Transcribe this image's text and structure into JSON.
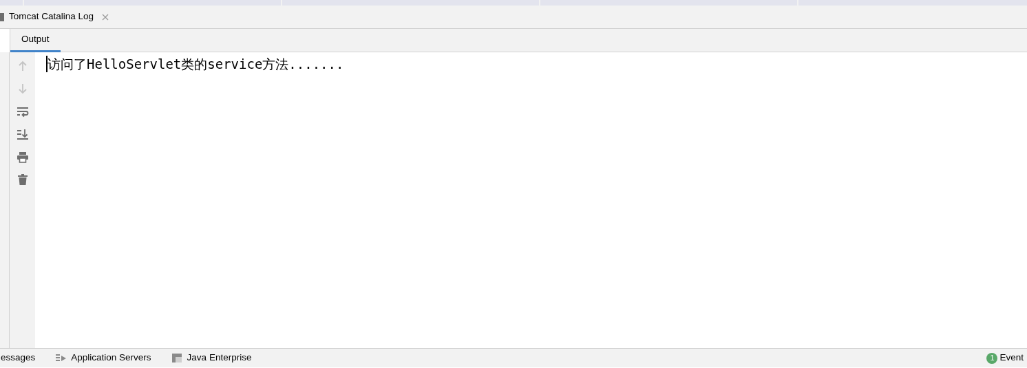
{
  "tool_window": {
    "title": "Tomcat Catalina Log"
  },
  "tabs": [
    {
      "label": "Output",
      "selected": true
    }
  ],
  "toolbar": [
    {
      "kind": "up",
      "disabled": true
    },
    {
      "kind": "down",
      "disabled": true
    },
    {
      "kind": "wrap",
      "disabled": false
    },
    {
      "kind": "scroll-end",
      "disabled": false
    },
    {
      "kind": "print",
      "disabled": false
    },
    {
      "kind": "trash",
      "disabled": false
    }
  ],
  "console": {
    "lines": [
      "访问了HelloServlet类的service方法......."
    ]
  },
  "status_bar": {
    "items": [
      {
        "kind": "none",
        "label": "essages"
      },
      {
        "kind": "servers",
        "label": "Application Servers"
      },
      {
        "kind": "enterprise",
        "label": "Java Enterprise"
      }
    ],
    "event_log": {
      "count": "1",
      "label": "Event"
    }
  }
}
